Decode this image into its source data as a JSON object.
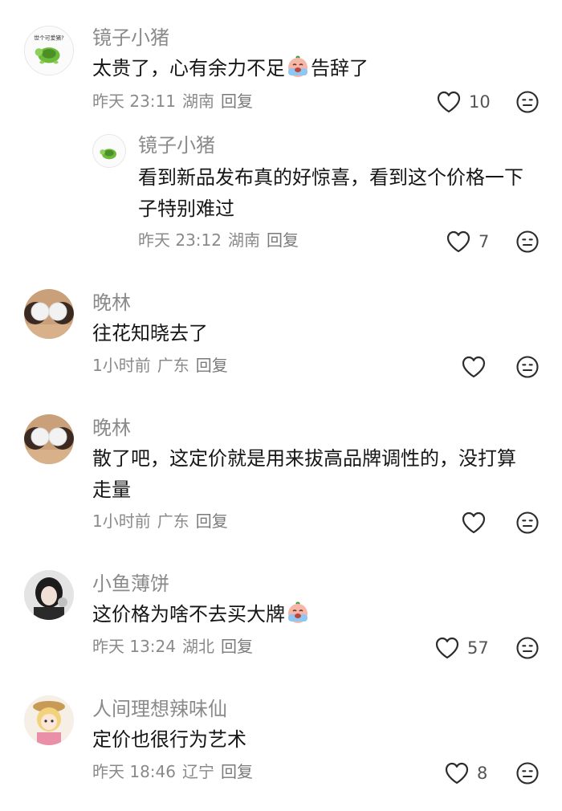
{
  "comments": [
    {
      "username": "镜子小猪",
      "text": "太贵了，心有余力不足",
      "text_after": "告辞了",
      "time": "昨天 23:11",
      "location": "湖南",
      "reply_label": "回复",
      "likes": "10",
      "avatar_text": "世个可爱猪?"
    },
    {
      "username": "镜子小猪",
      "text": "看到新品发布真的好惊喜，看到这个价格一下子特别难过",
      "time": "昨天 23:12",
      "location": "湖南",
      "reply_label": "回复",
      "likes": "7"
    },
    {
      "username": "晚林",
      "text": "往花知晓去了",
      "time": "1小时前",
      "location": "广东",
      "reply_label": "回复",
      "likes": ""
    },
    {
      "username": "晚林",
      "text": "散了吧，这定价就是用来拔高品牌调性的，没打算走量",
      "time": "1小时前",
      "location": "广东",
      "reply_label": "回复",
      "likes": ""
    },
    {
      "username": "小鱼薄饼",
      "text": "这价格为啥不去买大牌",
      "time": "昨天 13:24",
      "location": "湖北",
      "reply_label": "回复",
      "likes": "57"
    },
    {
      "username": "人间理想辣味仙",
      "text": "定价也很行为艺术",
      "time": "昨天 18:46",
      "location": "辽宁",
      "reply_label": "回复",
      "likes": "8"
    }
  ],
  "icons": {
    "like": "heart-outline-icon",
    "dislike": "neutral-face-icon",
    "emoji_cry": "crying-face-emoji"
  },
  "colors": {
    "username": "#8a8a8a",
    "text": "#161616",
    "meta": "#8a8a8a",
    "icon": "#333333"
  }
}
